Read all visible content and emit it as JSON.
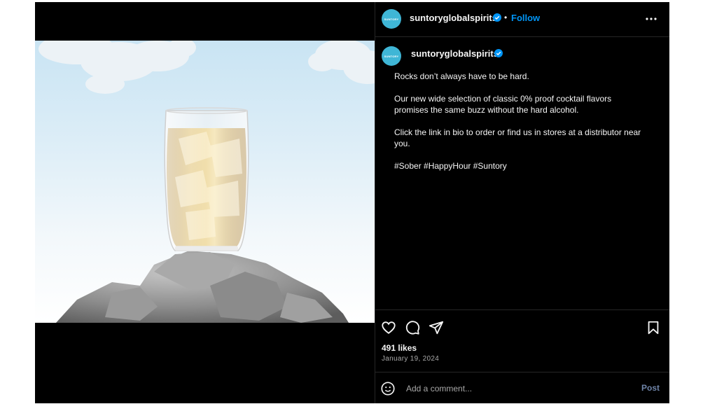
{
  "account": {
    "avatar_text": "SUNTORY",
    "username": "suntoryglobalspirits",
    "separator": "•",
    "follow_label": "Follow"
  },
  "caption": {
    "username": "suntoryglobalspirits",
    "paragraphs": [
      "Rocks don’t always have to be hard.",
      "Our new wide selection of classic 0% proof cocktail flavors promises the same buzz without the hard alcohol.",
      "Click the link in bio to order or find us in stores at a distributor near you.",
      "#Sober #HappyHour #Suntory"
    ]
  },
  "engagement": {
    "likes": "491 likes",
    "date": "January 19, 2024"
  },
  "comment": {
    "placeholder": "Add a comment...",
    "post_label": "Post"
  },
  "icons": [
    "verified-badge-icon",
    "more-options-icon",
    "heart-icon",
    "comment-icon",
    "share-icon",
    "bookmark-icon",
    "emoji-icon"
  ],
  "colors": {
    "background": "#000000",
    "text": "#f5f5f5",
    "muted": "#a8a8a8",
    "accent": "#0095f6",
    "avatar": "#3fb6d6"
  }
}
